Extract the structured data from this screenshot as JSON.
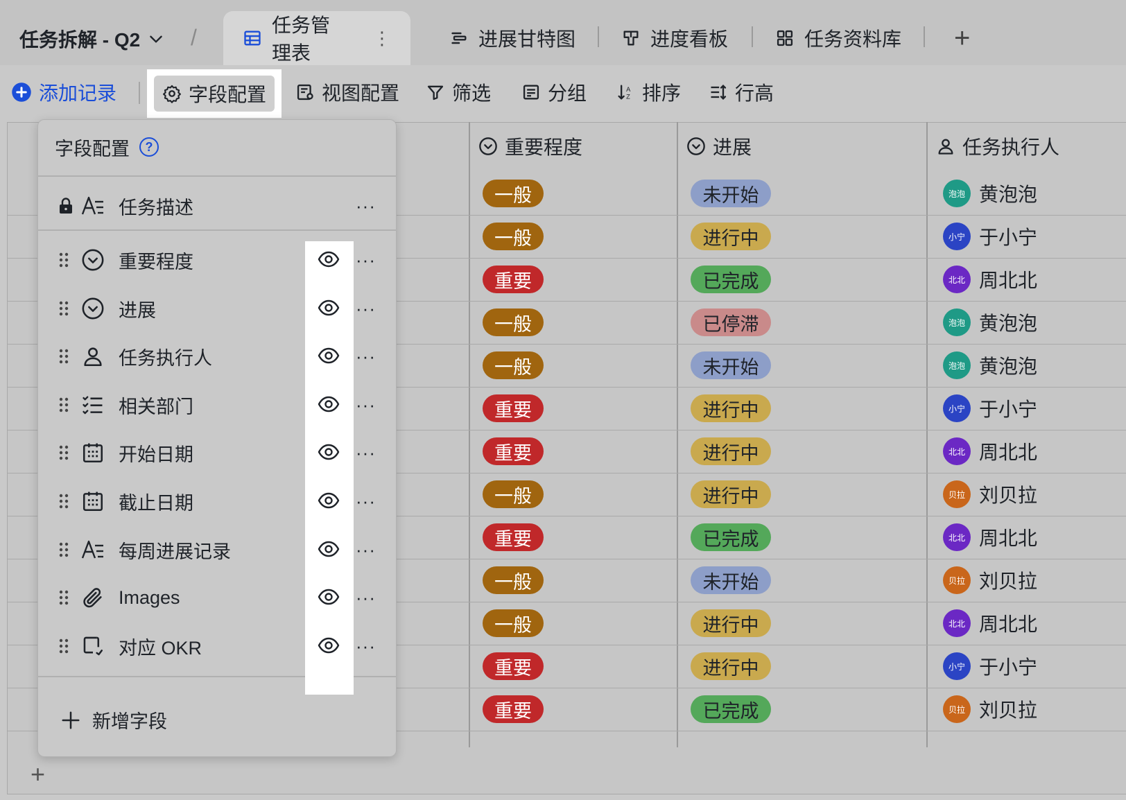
{
  "tabbar": {
    "base_title": "任务拆解 - Q2",
    "tabs": [
      {
        "label": "任务管理表",
        "icon": "table-icon",
        "active": true
      },
      {
        "label": "进展甘特图",
        "icon": "gantt-icon"
      },
      {
        "label": "进度看板",
        "icon": "kanban-icon"
      },
      {
        "label": "任务资料库",
        "icon": "grid-gallery-icon"
      }
    ],
    "add_tab": "+"
  },
  "toolbar": {
    "add_record": "添加记录",
    "field_config": "字段配置",
    "view_config": "视图配置",
    "filter": "筛选",
    "group": "分组",
    "sort": "排序",
    "row_height": "行高"
  },
  "columns": {
    "importance": "重要程度",
    "progress": "进展",
    "assignee": "任务执行人"
  },
  "rows": [
    {
      "importance": "一般",
      "progress": "未开始",
      "assignee": "黄泡泡",
      "avatar": "泡泡"
    },
    {
      "importance": "一般",
      "progress": "进行中",
      "assignee": "于小宁",
      "avatar": "小宁"
    },
    {
      "importance": "重要",
      "progress": "已完成",
      "assignee": "周北北",
      "avatar": "北北"
    },
    {
      "importance": "一般",
      "progress": "已停滞",
      "assignee": "黄泡泡",
      "avatar": "泡泡"
    },
    {
      "importance": "一般",
      "progress": "未开始",
      "assignee": "黄泡泡",
      "avatar": "泡泡"
    },
    {
      "importance": "重要",
      "progress": "进行中",
      "assignee": "于小宁",
      "avatar": "小宁"
    },
    {
      "importance": "重要",
      "progress": "进行中",
      "assignee": "周北北",
      "avatar": "北北"
    },
    {
      "importance": "一般",
      "progress": "进行中",
      "assignee": "刘贝拉",
      "avatar": "贝拉"
    },
    {
      "importance": "重要",
      "progress": "已完成",
      "assignee": "周北北",
      "avatar": "北北"
    },
    {
      "importance": "一般",
      "progress": "未开始",
      "assignee": "刘贝拉",
      "avatar": "贝拉"
    },
    {
      "importance": "一般",
      "progress": "进行中",
      "assignee": "周北北",
      "avatar": "北北"
    },
    {
      "importance": "重要",
      "progress": "进行中",
      "assignee": "于小宁",
      "avatar": "小宁"
    },
    {
      "importance": "重要",
      "progress": "已完成",
      "assignee": "刘贝拉",
      "avatar": "贝拉"
    }
  ],
  "colors": {
    "importance": {
      "一般": "#a0650f",
      "重要": "#c0282a"
    },
    "progress": {
      "未开始": "#8d9ec8",
      "进行中": "#c9a94e",
      "已完成": "#54a85a",
      "已停滞": "#c98a8a"
    },
    "avatar": {
      "泡泡": "#1f9a86",
      "小宁": "#2b44c4",
      "北北": "#6b28c4",
      "贝拉": "#c9661b"
    },
    "accent": "#1b4ed8"
  },
  "panel": {
    "title": "字段配置",
    "help": "?",
    "primary_field": {
      "label": "任务描述",
      "icon": "text-field-icon"
    },
    "fields": [
      {
        "label": "重要程度",
        "icon": "single-select-icon"
      },
      {
        "label": "进展",
        "icon": "single-select-icon"
      },
      {
        "label": "任务执行人",
        "icon": "person-icon"
      },
      {
        "label": "相关部门",
        "icon": "multi-select-icon"
      },
      {
        "label": "开始日期",
        "icon": "calendar-icon"
      },
      {
        "label": "截止日期",
        "icon": "calendar-icon"
      },
      {
        "label": "每周进展记录",
        "icon": "text-field-icon"
      },
      {
        "label": "Images",
        "icon": "attachment-icon"
      },
      {
        "label": "对应 OKR",
        "icon": "link-icon"
      }
    ],
    "new_field": "新增字段",
    "more": "···"
  }
}
